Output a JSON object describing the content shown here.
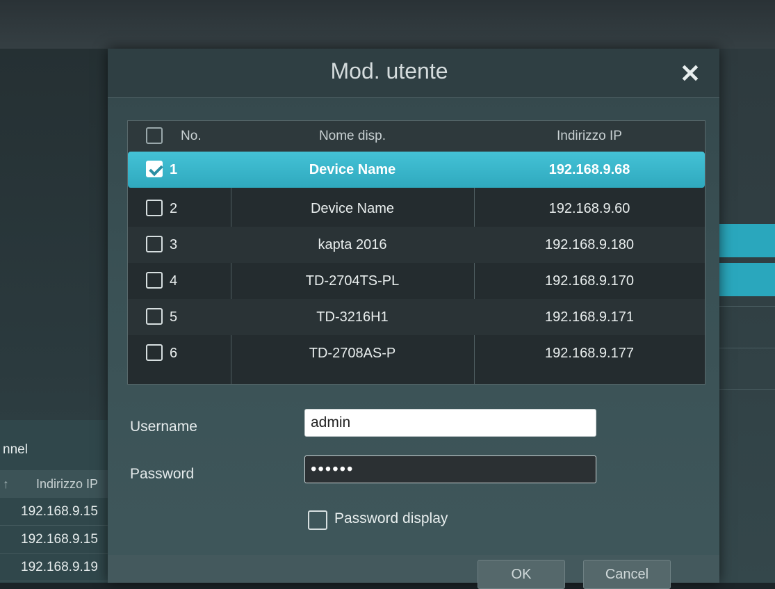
{
  "background": {
    "channel_label": "nnel",
    "ip_header_mark": "↑",
    "ip_header_label": "Indirizzo IP",
    "ip_rows": [
      "192.168.9.15",
      "192.168.9.15",
      "192.168.9.19"
    ]
  },
  "dialog": {
    "title": "Mod. utente",
    "close_icon": "close-icon",
    "table": {
      "headers": {
        "no": "No.",
        "name": "Nome disp.",
        "ip": "Indirizzo IP"
      },
      "rows": [
        {
          "no": "1",
          "name": "Device Name",
          "ip": "192.168.9.68",
          "checked": true
        },
        {
          "no": "2",
          "name": "Device Name",
          "ip": "192.168.9.60",
          "checked": false
        },
        {
          "no": "3",
          "name": "kapta 2016",
          "ip": "192.168.9.180",
          "checked": false
        },
        {
          "no": "4",
          "name": "TD-2704TS-PL",
          "ip": "192.168.9.170",
          "checked": false
        },
        {
          "no": "5",
          "name": "TD-3216H1",
          "ip": "192.168.9.171",
          "checked": false
        },
        {
          "no": "6",
          "name": "TD-2708AS-P",
          "ip": "192.168.9.177",
          "checked": false
        }
      ]
    },
    "form": {
      "username_label": "Username",
      "username_value": "admin",
      "password_label": "Password",
      "password_value": "••••••",
      "password_display_label": "Password display"
    },
    "buttons": {
      "ok": "OK",
      "cancel": "Cancel"
    }
  },
  "colors": {
    "accent_selected_row": "#35b3c8",
    "dialog_bg": "#3a5155"
  }
}
